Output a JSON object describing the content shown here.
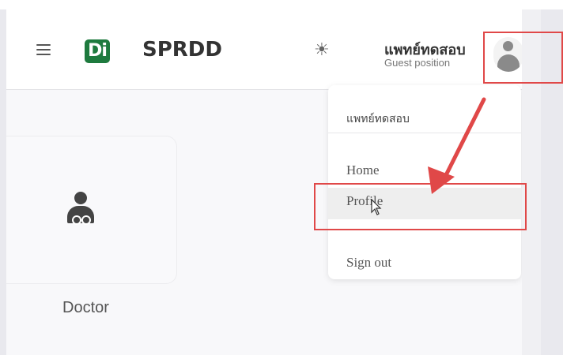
{
  "header": {
    "app_title": "SPRDD",
    "logo_text": "Di",
    "user_name": "แพทย์ทดสอบ",
    "user_role": "Guest position"
  },
  "card": {
    "label": "Doctor"
  },
  "user_menu": {
    "header": "แพทย์ทดสอบ",
    "items": [
      "Home",
      "Profile",
      "Sign out"
    ]
  },
  "icons": {
    "menu": "hamburger-menu-icon",
    "theme": "sun-icon",
    "avatar": "user-avatar-icon",
    "doctor": "doctor-icon"
  },
  "colors": {
    "logo_bg": "#1e7a3e",
    "annotation": "#e04848"
  }
}
